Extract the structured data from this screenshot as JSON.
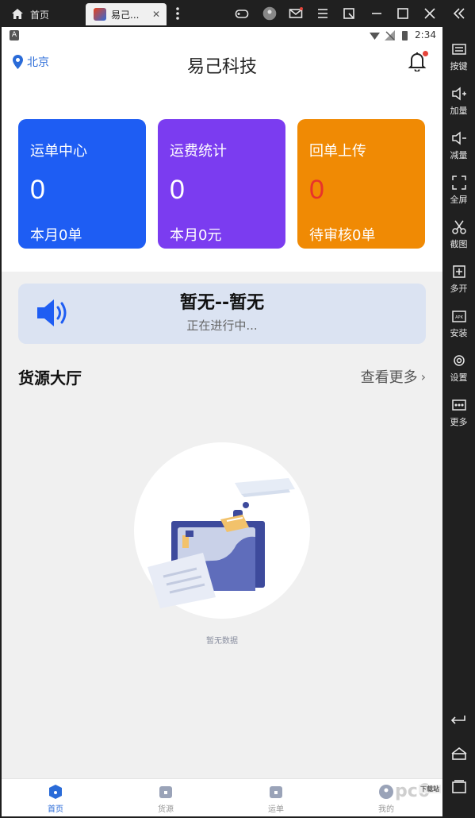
{
  "emulator": {
    "home_tab": "首页",
    "app_tab": "易己...",
    "side_items": [
      {
        "label": "按键",
        "icon": "keyboard-icon"
      },
      {
        "label": "加量",
        "icon": "volume-up-icon"
      },
      {
        "label": "减量",
        "icon": "volume-down-icon"
      },
      {
        "label": "全屏",
        "icon": "fullscreen-icon"
      },
      {
        "label": "截图",
        "icon": "scissors-icon"
      },
      {
        "label": "多开",
        "icon": "multi-open-icon"
      },
      {
        "label": "安装",
        "icon": "apk-install-icon"
      },
      {
        "label": "设置",
        "icon": "gear-icon"
      },
      {
        "label": "更多",
        "icon": "more-icon"
      }
    ]
  },
  "status_bar": {
    "time": "2:34",
    "notice_icon": "A"
  },
  "header": {
    "location": "北京",
    "title": "易己科技"
  },
  "cards": [
    {
      "title": "运单中心",
      "value": "0",
      "sub": "本月0单",
      "color": "#1e5df3"
    },
    {
      "title": "运费统计",
      "value": "0",
      "sub": "本月0元",
      "color": "#7b3cf0"
    },
    {
      "title": "回单上传",
      "value": "0",
      "sub": "待审核0单",
      "color": "#f08a04"
    }
  ],
  "notice": {
    "title": "暂无--暂无",
    "subtitle": "正在进行中..."
  },
  "section": {
    "title": "货源大厅",
    "more": "查看更多"
  },
  "empty": {
    "text": "暂无数据"
  },
  "tabbar": {
    "tabs": [
      {
        "label": "首页",
        "active": true
      },
      {
        "label": "货源",
        "active": false
      },
      {
        "label": "运单",
        "active": false
      },
      {
        "label": "我的",
        "active": false
      }
    ]
  },
  "watermark": {
    "text": "pc6",
    "badge": "下载站"
  }
}
